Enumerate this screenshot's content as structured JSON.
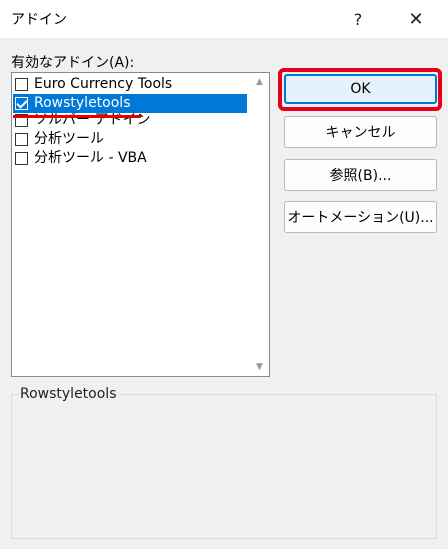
{
  "window": {
    "title": "アドイン",
    "help_glyph": "?",
    "close_glyph": "✕"
  },
  "addins": {
    "label": "有効なアドイン(A):",
    "items": [
      {
        "label": "Euro Currency Tools",
        "checked": false,
        "selected": false
      },
      {
        "label": "Rowstyletools",
        "checked": true,
        "selected": true
      },
      {
        "label": "ソルバー アドイン",
        "checked": false,
        "selected": false
      },
      {
        "label": "分析ツール",
        "checked": false,
        "selected": false
      },
      {
        "label": "分析ツール - VBA",
        "checked": false,
        "selected": false
      }
    ]
  },
  "buttons": {
    "ok": "OK",
    "cancel": "キャンセル",
    "browse": "参照(B)...",
    "automation": "オートメーション(U)..."
  },
  "description": {
    "title": "Rowstyletools"
  },
  "colors": {
    "selection": "#0078d7",
    "annotation": "#e6001a"
  },
  "icons": {
    "help": "help-icon",
    "close": "close-icon",
    "scroll_up": "scroll-up-arrow-icon",
    "scroll_down": "scroll-down-arrow-icon",
    "check": "check-icon"
  }
}
